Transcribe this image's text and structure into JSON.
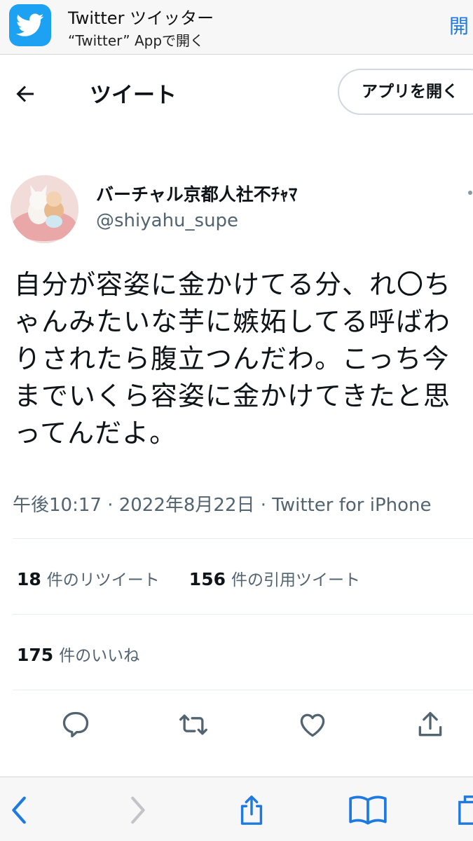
{
  "banner": {
    "app_name": "Twitter ツイッター",
    "subtitle": "“Twitter” Appで開く",
    "open_label": "開",
    "icon": "twitter-bird-icon",
    "accent_color": "#1da1f2"
  },
  "header": {
    "back_icon": "back-arrow-icon",
    "title": "ツイート",
    "open_app_label": "アプリを開く"
  },
  "tweet": {
    "author_name": "バーチャル京都人社不ﾁｬﾏ",
    "author_handle": "@shiyahu_supe",
    "text": "自分が容姿に金かけてる分、れ〇ちゃんみたいな芋に嫉妬してる呼ばわりされたら腹立つんだわ。こっち今までいくら容姿に金かけてきたと思ってんだよ。",
    "meta": "午後10:17 · 2022年8月22日 · Twitter for iPhone"
  },
  "stats": {
    "retweets_count": "18",
    "retweets_label": "件のリツイート",
    "quotes_count": "156",
    "quotes_label": "件の引用ツイート",
    "likes_count": "175",
    "likes_label": "件のいいね"
  },
  "actions": [
    "reply-icon",
    "retweet-icon",
    "like-icon",
    "share-icon"
  ],
  "safari_toolbar": [
    "back-chevron-icon",
    "forward-chevron-icon",
    "share-icon",
    "bookmarks-icon",
    "tabs-icon"
  ],
  "colors": {
    "link_blue": "#1f7ae0",
    "secondary_text": "#536471"
  }
}
